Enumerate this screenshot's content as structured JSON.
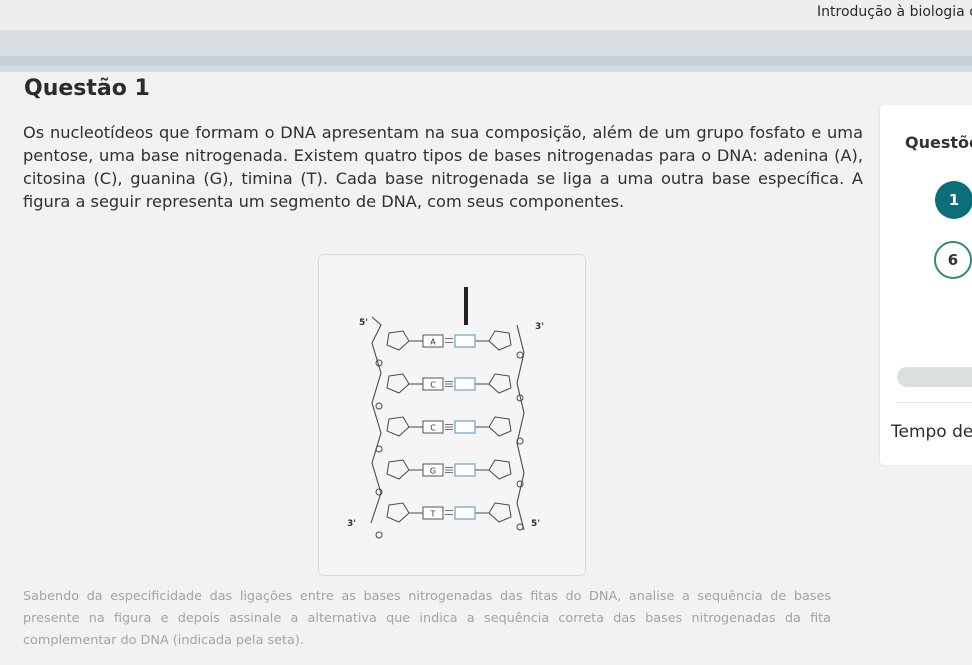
{
  "header": {
    "course_title": "Introdução à biologia c"
  },
  "question": {
    "heading": "Questão 1",
    "text": "Os nucleotídeos que formam o DNA apresentam na sua composição, além de um grupo fosfato e uma pentose, uma base nitrogenada. Existem quatro tipos de bases nitrogenadas para o DNA: adenina (A), citosina (C), guanina (G), timina (T). Cada base nitrogenada se liga a uma outra base específica. A figura a seguir representa um segmento de DNA, com seus componentes.",
    "continuation": "Sabendo da especificidade das ligações entre as bases nitrogenadas das fitas do DNA, analise a sequência de bases presente na figura e depois assinale a alternativa que indica a sequência correta das bases nitrogenadas da fita complementar do DNA (indicada pela seta)."
  },
  "figure": {
    "label_5_top": "5'",
    "label_3_top": "3'",
    "label_3_bottom": "3'",
    "label_5_bottom": "5'",
    "bases": [
      "A",
      "C",
      "C",
      "G",
      "T"
    ]
  },
  "sidebar": {
    "title": "Questõe",
    "nav_items": [
      "1",
      "6"
    ],
    "timer_label": "Tempo de"
  },
  "colors": {
    "accent": "#0b6e79",
    "ring": "#2c8a78",
    "banner": "#d7dde1"
  }
}
